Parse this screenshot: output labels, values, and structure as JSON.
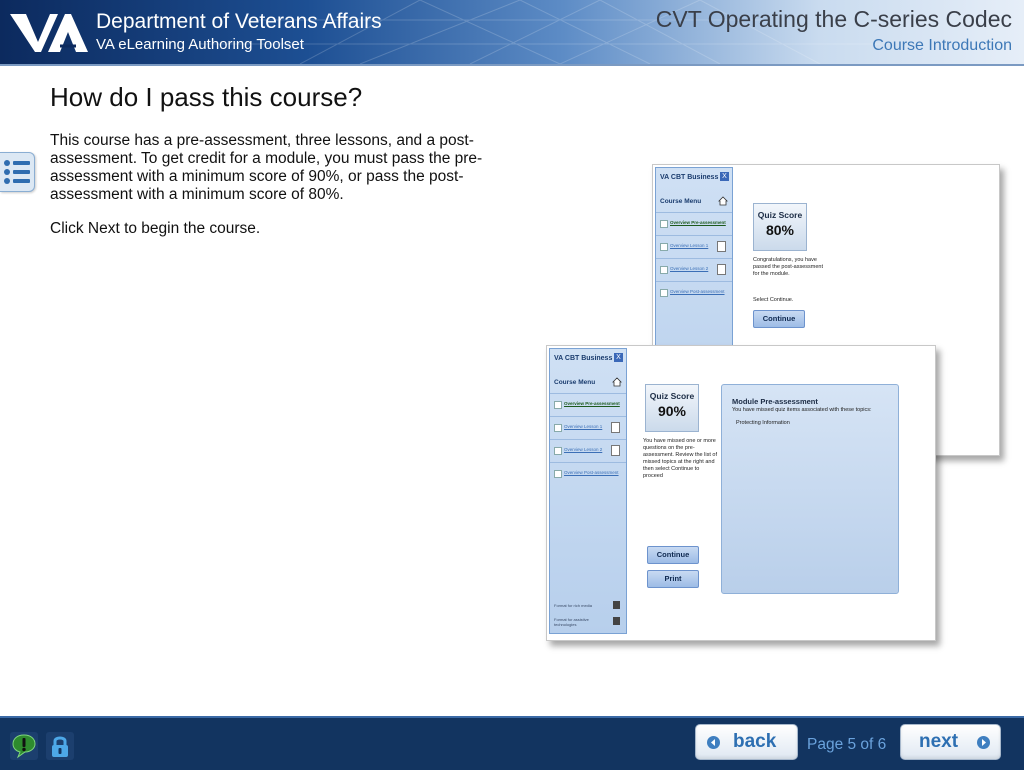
{
  "header": {
    "org_title": "Department of Veterans Affairs",
    "org_subtitle": "VA eLearning Authoring Toolset",
    "course_title": "CVT Operating the C-series Codec",
    "section_title": "Course Introduction"
  },
  "content": {
    "heading": "How do I pass this course?",
    "paragraph1": "This course has a pre-assessment, three lessons, and a post-assessment. To get credit for a module, you must pass the pre-assessment with a minimum score of 90%, or pass the post-assessment with a minimum score of 80%.",
    "paragraph2": "Click Next to begin the course."
  },
  "illustration": {
    "back": {
      "brand": "VA CBT Business",
      "close": "X",
      "menu_title": "Course Menu",
      "items": [
        {
          "label": "Overview Pre-assessment",
          "done": true
        },
        {
          "label": "Overview Lesson 1",
          "done": false
        },
        {
          "label": "Overview Lesson 2",
          "done": false
        },
        {
          "label": "Overview Post-assessment",
          "done": false
        }
      ],
      "quiz_label": "Quiz Score",
      "quiz_score": "80%",
      "message": "Congratulations, you have passed the post-assessment for the module.",
      "instruction": "Select Continue.",
      "continue_label": "Continue"
    },
    "front": {
      "brand": "VA CBT Business",
      "close": "X",
      "menu_title": "Course Menu",
      "items": [
        {
          "label": "Overview Pre-assessment",
          "done": true
        },
        {
          "label": "Overview Lesson 1",
          "done": false
        },
        {
          "label": "Overview Lesson 2",
          "done": false
        },
        {
          "label": "Overview Post-assessment",
          "done": false
        }
      ],
      "footer_items": [
        "Format for rich media",
        "Format for assistive technologies"
      ],
      "quiz_label": "Quiz Score",
      "quiz_score": "90%",
      "message": "You have missed one or more questions on the pre-assessment. Review the list of missed topics at the right and then select Continue to proceed",
      "continue_label": "Continue",
      "print_label": "Print",
      "module_title": "Module Pre-assessment",
      "module_subtitle": "You have missed quiz items associated with these topics:",
      "module_topic": "Protecting Information"
    }
  },
  "footer": {
    "back_label": "back",
    "next_label": "next",
    "page_indicator": "Page 5 of 6"
  },
  "colors": {
    "header_dark": "#0c2a5e",
    "footer_bg": "#123460",
    "accent_blue": "#2d6fb2",
    "page_indicator": "#6aa2dc",
    "feedback_green": "#2e8b2e"
  },
  "icons": {
    "menu": "list-menu-icon",
    "feedback": "feedback-exclamation-icon",
    "lock": "lock-icon",
    "back": "arrow-left-circle-icon",
    "next": "arrow-right-circle-icon"
  }
}
